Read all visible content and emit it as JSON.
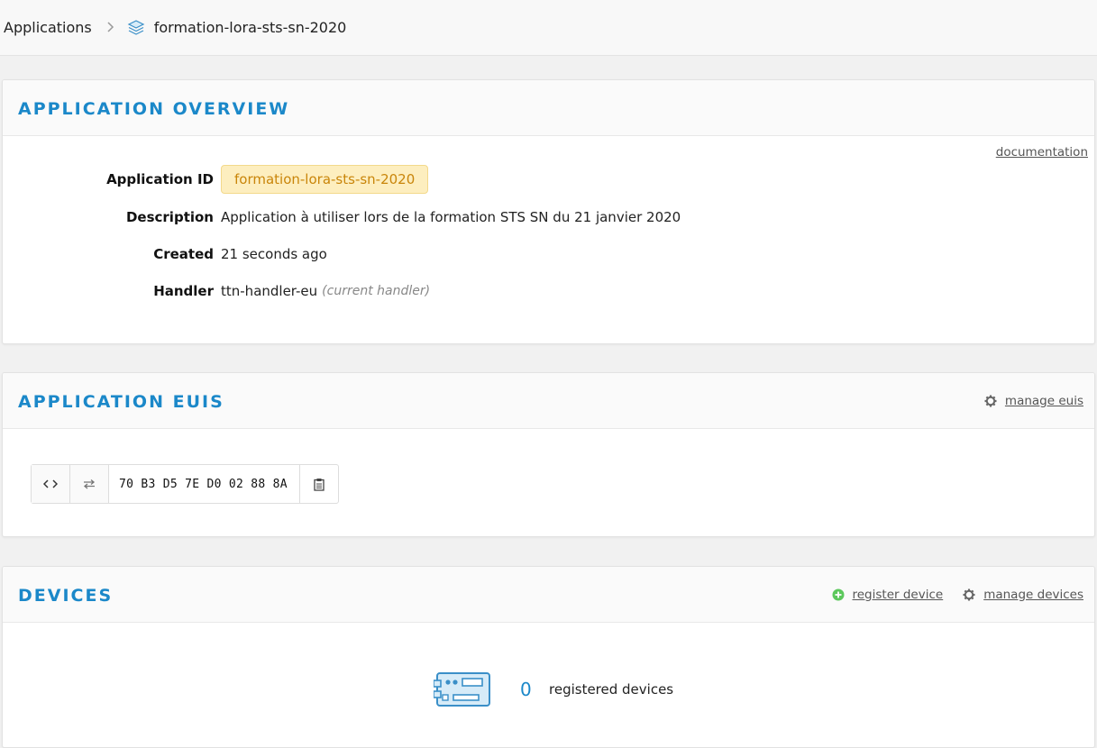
{
  "breadcrumb": {
    "root": "Applications",
    "separator": ">",
    "current": "formation-lora-sts-sn-2020"
  },
  "overview": {
    "title": "APPLICATION OVERVIEW",
    "documentation_link": "documentation",
    "application_id_label": "Application ID",
    "application_id": "formation-lora-sts-sn-2020",
    "description_label": "Description",
    "description": "Application à utiliser lors de la formation STS SN du 21 janvier 2020",
    "created_label": "Created",
    "created": "21 seconds ago",
    "handler_label": "Handler",
    "handler": "ttn-handler-eu",
    "handler_hint": "(current handler)"
  },
  "euis": {
    "title": "APPLICATION EUIS",
    "manage_label": "manage euis",
    "eui_value": "70 B3 D5 7E D0 02 88 8A",
    "format_icon": "code-icon",
    "swap_icon": "swap-icon",
    "copy_icon": "clipboard-icon"
  },
  "devices": {
    "title": "DEVICES",
    "register_label": "register device",
    "manage_label": "manage devices",
    "count": "0",
    "count_label": "registered devices"
  },
  "colors": {
    "accent": "#1b88c9",
    "pill_bg": "#fdeebf",
    "pill_text": "#c9850a",
    "add_green": "#5cc85c"
  }
}
